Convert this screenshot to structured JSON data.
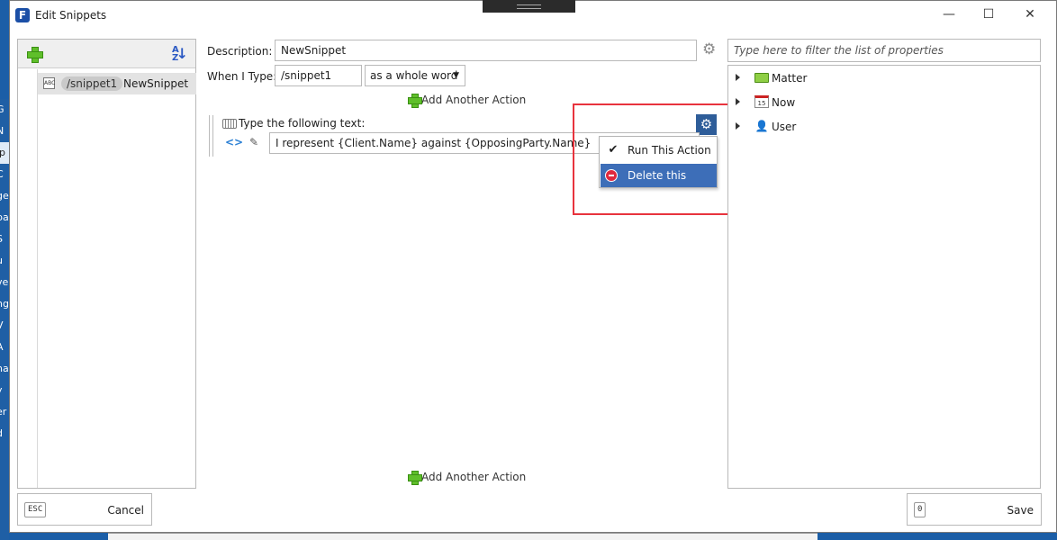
{
  "window": {
    "title": "Edit Snippets",
    "app_icon": "F",
    "minimize": "—",
    "maximize": "☐",
    "close": "✕"
  },
  "background": {
    "strip_items": [
      "G",
      "N",
      "ip",
      "C",
      "ge",
      "pa",
      "S",
      "u",
      "ve",
      "ng",
      "V",
      "A",
      "ha",
      "y",
      "er",
      "d"
    ]
  },
  "sidebar": {
    "add_icon": "plus-icon",
    "sort_icon": "sort-az-icon",
    "sort_text_a": "A",
    "sort_text_z": "Z",
    "items": [
      {
        "type_icon": "ABC",
        "shortcut": "/snippet1",
        "name": "NewSnippet"
      }
    ]
  },
  "form": {
    "description_label": "Description:",
    "description_value": "NewSnippet",
    "when_type_label": "When I Type:",
    "trigger_value": "/snippet1",
    "match_mode": "as a whole word",
    "add_action_label": "Add Another Action",
    "add_action_bottom_label": "Add Another Action"
  },
  "action": {
    "title": "Type the following text:",
    "text": "I represent {Client.Name} against {OpposingParty.Name}",
    "code_icon": "<>",
    "magic_icon": "✎"
  },
  "context_menu": {
    "items": [
      {
        "label": "Run This Action",
        "icon": "check-icon",
        "glyph": "✔"
      },
      {
        "label": "Delete this Action",
        "icon": "no-entry-icon",
        "glyph": ""
      }
    ],
    "active_index": 1
  },
  "properties": {
    "filter_placeholder": "Type here to filter the list of properties",
    "items": [
      {
        "label": "Matter",
        "icon": "folder-icon"
      },
      {
        "label": "Now",
        "icon": "calendar-icon",
        "glyph": "15"
      },
      {
        "label": "User",
        "icon": "user-icon",
        "glyph": "👤"
      }
    ]
  },
  "footer": {
    "cancel_key": "ESC",
    "cancel_label": "Cancel",
    "save_key": "0",
    "save_label": "Save"
  },
  "colors": {
    "accent": "#3d6eb8",
    "annotation": "#e8333d",
    "plus_green": "#5fbf2a"
  }
}
